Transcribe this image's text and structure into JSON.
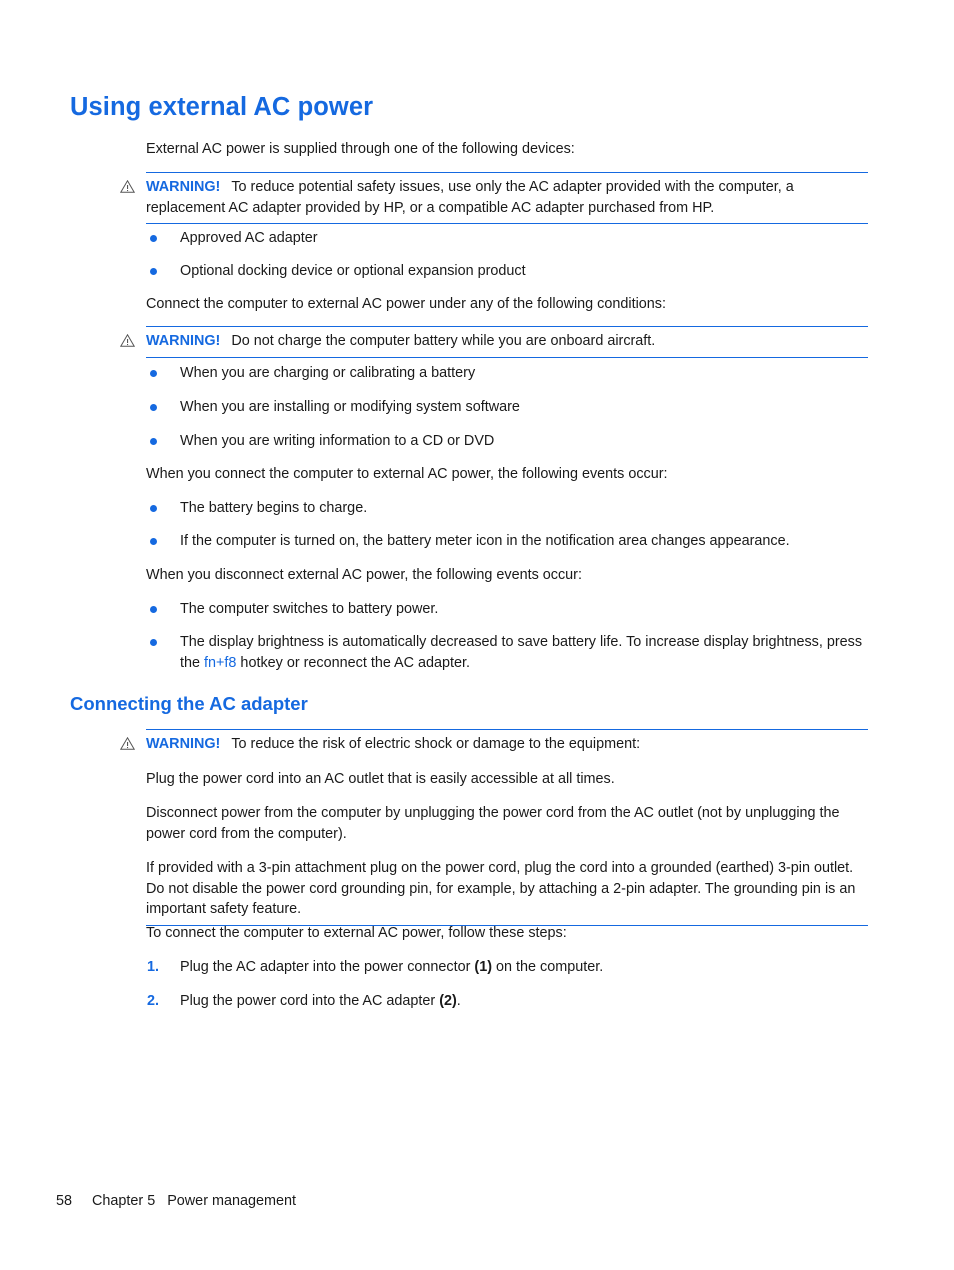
{
  "document": {
    "heading": "Using external AC power",
    "intro": "External AC power is supplied through one of the following devices:",
    "accent_color": "#1569e0",
    "text_color": "#1a1a1a"
  },
  "warning1": {
    "icon": "warning-triangle-icon",
    "label": "WARNING!",
    "text": "To reduce potential safety issues, use only the AC adapter provided with the computer, a replacement AC adapter provided by HP, or a compatible AC adapter purchased from HP."
  },
  "devices_list": [
    "Approved AC adapter",
    "Optional docking device or optional expansion product"
  ],
  "conditions_intro": "Connect the computer to external AC power under any of the following conditions:",
  "warning2": {
    "icon": "warning-triangle-icon",
    "label": "WARNING!",
    "text": "Do not charge the computer battery while you are onboard aircraft."
  },
  "conditions_list": [
    "When you are charging or calibrating a battery",
    "When you are installing or modifying system software",
    "When you are writing information to a CD or DVD"
  ],
  "connect_events_intro": "When you connect the computer to external AC power, the following events occur:",
  "connect_events_list": [
    "The battery begins to charge.",
    "If the computer is turned on, the battery meter icon in the notification area changes appearance."
  ],
  "disconnect_events_intro": "When you disconnect external AC power, the following events occur:",
  "disconnect_events_list": [
    {
      "text": "The computer switches to battery power."
    }
  ],
  "brightness_item": {
    "before": "The display brightness is automatically decreased to save battery life. To increase display brightness, press the ",
    "link": "fn+f8",
    "after": " hotkey or reconnect the AC adapter."
  },
  "subsection": {
    "heading": "Connecting the AC adapter",
    "warning": {
      "icon": "warning-triangle-icon",
      "label": "WARNING!",
      "text": "To reduce the risk of electric shock or damage to the equipment:",
      "paragraphs": [
        "Plug the power cord into an AC outlet that is easily accessible at all times.",
        "Disconnect power from the computer by unplugging the power cord from the AC outlet (not by unplugging the power cord from the computer).",
        "If provided with a 3-pin attachment plug on the power cord, plug the cord into a grounded (earthed) 3-pin outlet. Do not disable the power cord grounding pin, for example, by attaching a 2-pin adapter. The grounding pin is an important safety feature."
      ]
    },
    "steps_intro": "To connect the computer to external AC power, follow these steps:",
    "steps": [
      {
        "marker": "1.",
        "before": "Plug the AC adapter into the power connector ",
        "bold": "(1)",
        "after": " on the computer."
      },
      {
        "marker": "2.",
        "before": "Plug the power cord into the AC adapter ",
        "bold": "(2)",
        "after": "."
      }
    ]
  },
  "footer": {
    "page_number": "58",
    "chapter": "Chapter 5",
    "chapter_title": "Power management",
    "combined": "58     Chapter 5   Power management"
  }
}
